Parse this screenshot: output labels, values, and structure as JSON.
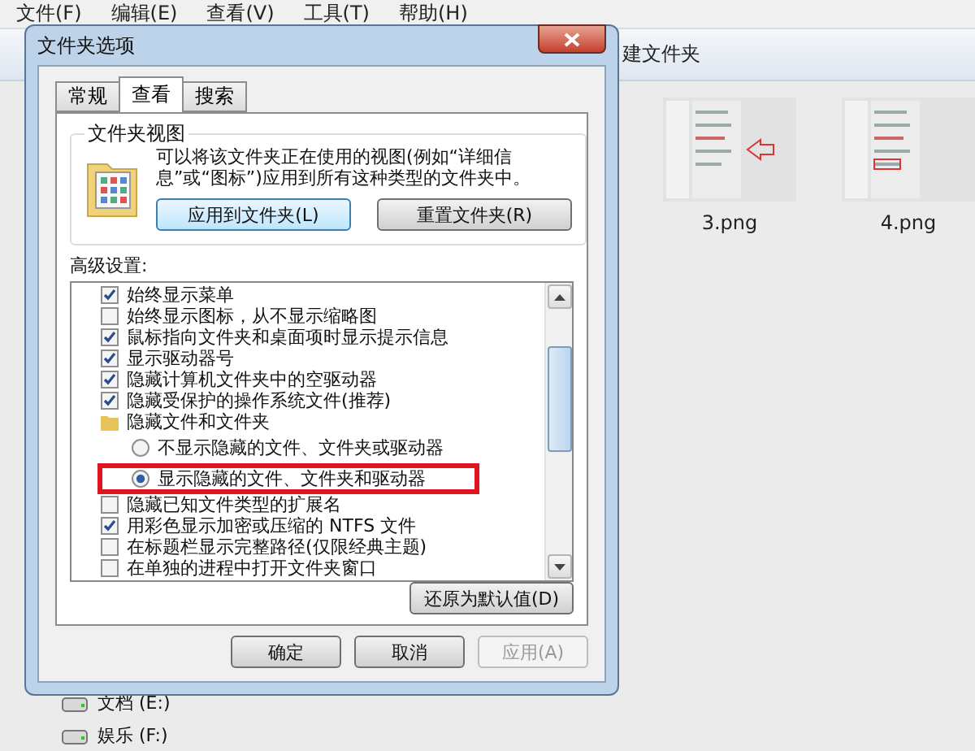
{
  "explorer": {
    "menu": [
      "文件(F)",
      "编辑(E)",
      "查看(V)",
      "工具(T)",
      "帮助(H)"
    ],
    "toolbar_text": "建文件夹",
    "thumbnails": [
      {
        "label": "3.png",
        "kind": "arrow"
      },
      {
        "label": "4.png",
        "kind": "box"
      }
    ],
    "drives": [
      "文档 (E:)",
      "娱乐 (F:)"
    ]
  },
  "dialog": {
    "title": "文件夹选项",
    "tabs": [
      {
        "label": "常规",
        "selected": false
      },
      {
        "label": "查看",
        "selected": true
      },
      {
        "label": "搜索",
        "selected": false
      }
    ],
    "folder_views": {
      "title": "文件夹视图",
      "description": "可以将该文件夹正在使用的视图(例如“详细信息”或“图标”)应用到所有这种类型的文件夹中。",
      "buttons": [
        "应用到文件夹(L)",
        "重置文件夹(R)"
      ]
    },
    "advanced_label": "高级设置:",
    "settings": [
      {
        "kind": "checkbox",
        "label": "始终显示菜单",
        "checked": true
      },
      {
        "kind": "checkbox",
        "label": "始终显示图标，从不显示缩略图",
        "checked": false
      },
      {
        "kind": "checkbox",
        "label": "鼠标指向文件夹和桌面项时显示提示信息",
        "checked": true
      },
      {
        "kind": "checkbox",
        "label": "显示驱动器号",
        "checked": true
      },
      {
        "kind": "checkbox",
        "label": "隐藏计算机文件夹中的空驱动器",
        "checked": true
      },
      {
        "kind": "checkbox",
        "label": "隐藏受保护的操作系统文件(推荐)",
        "checked": true
      },
      {
        "kind": "folder",
        "label": "隐藏文件和文件夹",
        "children": [
          {
            "kind": "radio",
            "label": "不显示隐藏的文件、文件夹或驱动器",
            "selected": false,
            "highlighted": false
          },
          {
            "kind": "radio",
            "label": "显示隐藏的文件、文件夹和驱动器",
            "selected": true,
            "highlighted": true
          }
        ]
      },
      {
        "kind": "checkbox",
        "label": "隐藏已知文件类型的扩展名",
        "checked": false
      },
      {
        "kind": "checkbox",
        "label": "用彩色显示加密或压缩的 NTFS 文件",
        "checked": true
      },
      {
        "kind": "checkbox",
        "label": "在标题栏显示完整路径(仅限经典主题)",
        "checked": false
      },
      {
        "kind": "checkbox",
        "label": "在单独的进程中打开文件夹窗口",
        "checked": false
      }
    ],
    "restore_button": "还原为默认值(D)",
    "buttons": [
      {
        "label": "确定",
        "disabled": false
      },
      {
        "label": "取消",
        "disabled": false
      },
      {
        "label": "应用(A)",
        "disabled": true
      }
    ]
  }
}
